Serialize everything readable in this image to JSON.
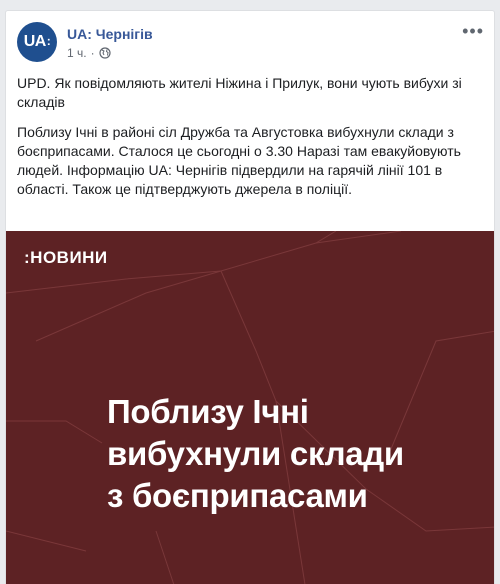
{
  "post": {
    "page_name": "UA: Чернігів",
    "avatar_text": "UA",
    "time": "1 ч.",
    "separator": "·",
    "more_label": "•••",
    "paragraphs": [
      "UPD. Як повідомляють жителі Ніжина і Прилук, вони чують вибухи зі складів",
      "Поблизу Ічні в районі сіл Дружба та Августовка вибухнули склади з боєприпасами. Сталося це сьогодні о 3.30 Наразі там евакуйовують людей. Інформацію UA: Чернігів підвердили на гарячій лінії 101 в області. Також це підтверджують джерела в поліції."
    ]
  },
  "image": {
    "brand": ":НОВИНИ",
    "headline_lines": [
      "Поблизу Ічні",
      "вибухнули склади",
      "з боєприпасами"
    ],
    "background_color": "#5d2224"
  },
  "colors": {
    "link": "#385898",
    "text": "#1c1e21",
    "meta": "#616770",
    "page_bg": "#e9ebee"
  },
  "icons": {
    "privacy": "globe-icon",
    "menu": "more-options-icon"
  }
}
